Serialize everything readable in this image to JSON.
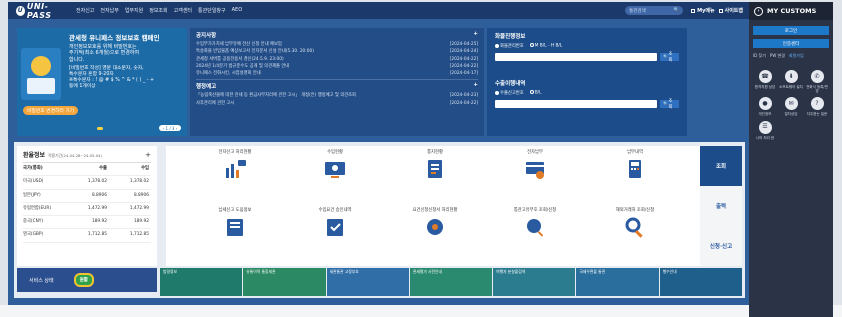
{
  "header": {
    "logo": "UNI-PASS",
    "nav": [
      "전자신고",
      "전자납부",
      "업무지원",
      "정보조회",
      "고객센터",
      "통관단일창구",
      "AEO"
    ],
    "search_placeholder": "통관검색",
    "my_menu": "My메뉴",
    "sitemap": "사이트맵"
  },
  "right_panel": {
    "title": "MY CUSTOMS",
    "login": "로그인",
    "cert_center": "인증센터",
    "links": [
      "ID 찾기",
      "PW 변경",
      "회원가입"
    ],
    "icons": [
      {
        "label": "원격지원 상담",
        "icon": "headset-icon"
      },
      {
        "label": "소프트웨어 설치",
        "icon": "download-icon"
      },
      {
        "label": "전화식 등록/변경",
        "icon": "phone-icon"
      },
      {
        "label": "개인정보",
        "icon": "person-icon"
      },
      {
        "label": "절차상담",
        "icon": "chat-icon"
      },
      {
        "label": "자주묻는 질문",
        "icon": "faq-icon"
      },
      {
        "label": "나의 처리 현",
        "icon": "list-icon"
      }
    ]
  },
  "banner": {
    "title": "관세청 유니패스 정보보호 캠페인",
    "lines": [
      "개인정보보호를 위해 비밀번호는",
      "주기적(최소 6개월)으로 변경하여",
      "합니다."
    ],
    "lines2": [
      "[비밀번호 작성] 영문 대소문자, 숫자,",
      "특수문자 혼합 9-20자",
      "※특수문자 : ! @ # $ % ^ & * ( ) _ - +",
      "등에 1개이상"
    ],
    "cta": "비밀번호 변경하러 가기",
    "pager": "1 / 3"
  },
  "notice": {
    "title": "공지사항",
    "items": [
      {
        "text": "수입부가가치세 납부유예 전산 신청 안내 예보업",
        "date": "[2024-04-25]"
      },
      {
        "text": "특송화물 반입물품 예상보고서 전자문서 신설 안내(5.30. 20:00)",
        "date": "[2024-04-24]"
      },
      {
        "text": "관세청 서버통 공용전용서 경신(24.5.9. 23:00)",
        "date": "[2024-04-22]"
      },
      {
        "text": "2024년 1/4분기 법규준수도 공개 및 의견제출 안내",
        "date": "[2024-04-22]"
      },
      {
        "text": "유니패스 전화시킨, 시업설명회 안내",
        "date": "[2024-04-17]"
      }
    ],
    "title2": "행정예고",
    "items2": [
      {
        "text": "「농림축산물에 대한 관세 등 환급사무처리에 관한 고시」 개정(안) 행정예고 및 의견조회",
        "date": "[2024-04-23]"
      },
      {
        "text": "사후관리에 관한 고시",
        "date": "[2024-04-22]"
      }
    ]
  },
  "cargo": {
    "title": "화물진행정보",
    "radio1": "화물관리번호",
    "radio2": "M B/L - H B/L",
    "button": "조회",
    "title2": "수출이행내역",
    "radio3": "수출신고번호",
    "radio4": "B/L",
    "button2": "조회"
  },
  "exchange": {
    "title": "환율정보",
    "period": "적용기간(24.04.28~24.05.04)",
    "headers": [
      "국가(통화)",
      "수출",
      "수입"
    ],
    "rows": [
      [
        "미국(USD)",
        "1,378.02",
        "1,378.02"
      ],
      [
        "일본(JPY)",
        "8.8906",
        "8.8906"
      ],
      [
        "유럽연합(EUR)",
        "1,472.99",
        "1,472.99"
      ],
      [
        "중국(CNY)",
        "189.92",
        "189.92"
      ],
      [
        "영국(GBP)",
        "1,712.85",
        "1,712.85"
      ]
    ]
  },
  "quick": {
    "row1": [
      "전자신고 처리현황",
      "수입현황",
      "통지현황",
      "전자납부",
      "납부내역"
    ],
    "row2": [
      "납세신고 도움정보",
      "수입요건 승인내역",
      "요건신청신청서 처리현황",
      "통관고유부호 조회/신청",
      "해외거래처 조회/신청"
    ]
  },
  "side_tabs": [
    "조회",
    "출력",
    "신청·신고"
  ],
  "service": {
    "label": "서비스 상태",
    "status": "원활"
  },
  "tiles": [
    {
      "label": "법령정보",
      "color": "#1f7a6b"
    },
    {
      "label": "유통이력 통합세관",
      "color": "#2b8a63"
    },
    {
      "label": "세관통관 고정부호",
      "color": "#2f6ea7"
    },
    {
      "label": "관세평가 사전안내",
      "color": "#2a8a6f"
    },
    {
      "label": "여행자 분실물검색",
      "color": "#2b7c8f"
    },
    {
      "label": "국제우편물 통관",
      "color": "#2a6e9d"
    },
    {
      "label": "행수안내",
      "color": "#1f5f8c"
    }
  ]
}
